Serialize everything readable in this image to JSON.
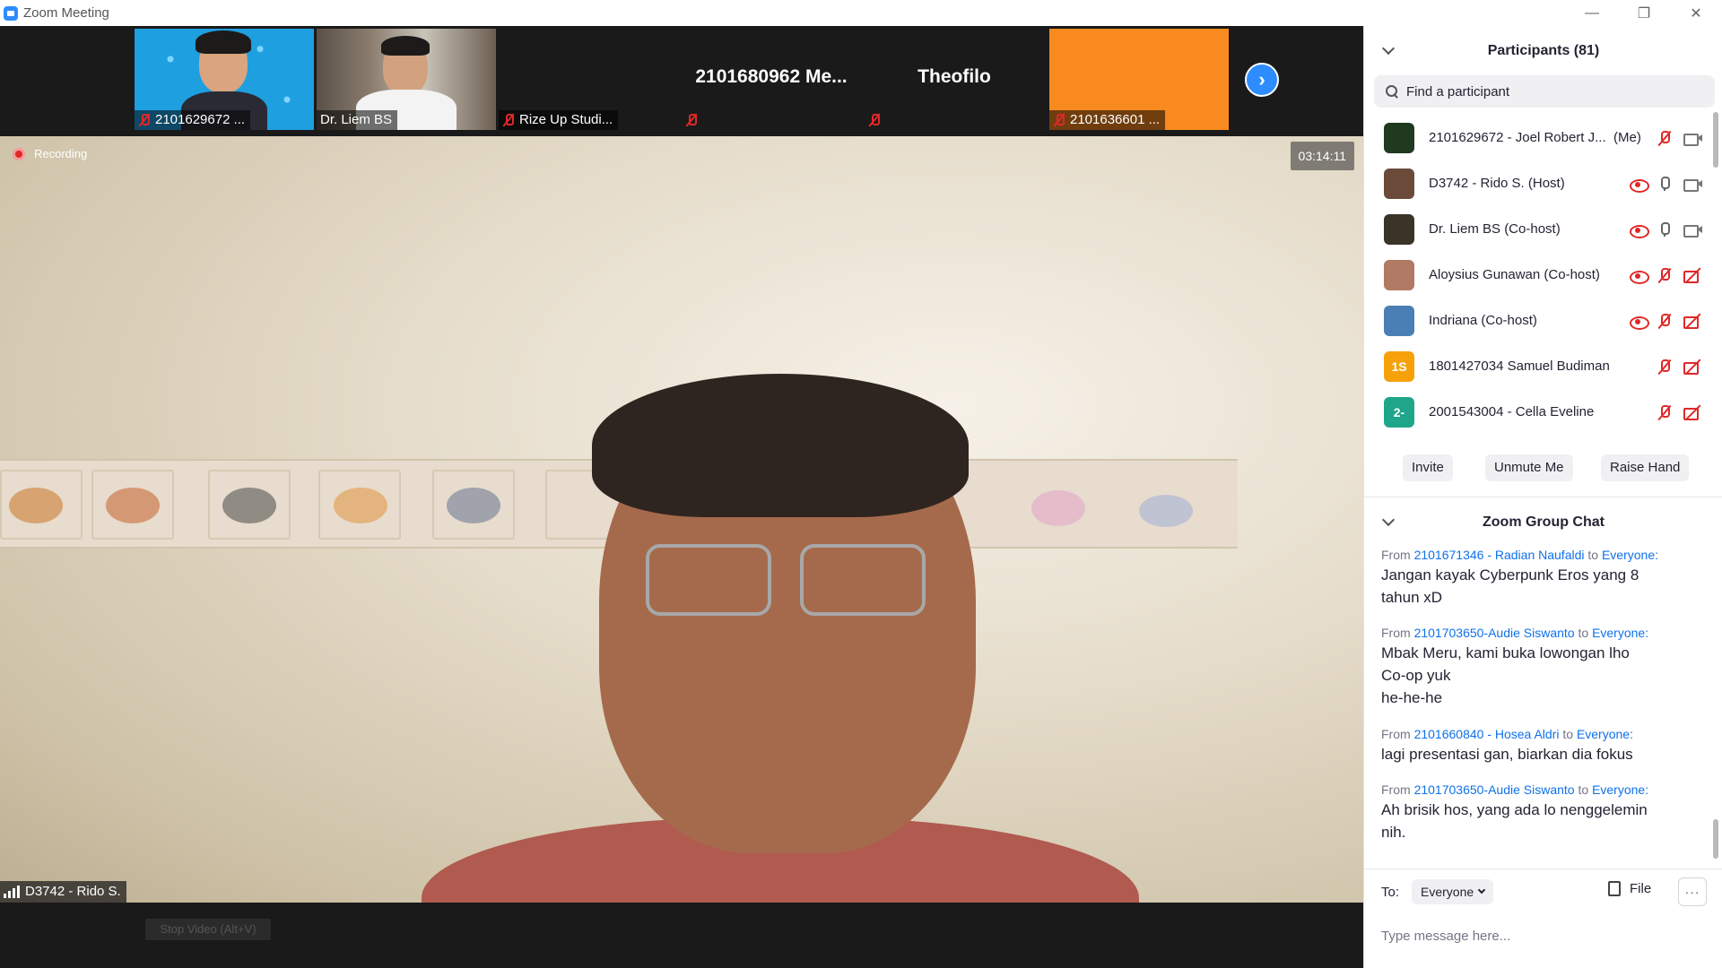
{
  "window": {
    "title": "Zoom Meeting",
    "controls": [
      "—",
      "❐",
      "✕"
    ]
  },
  "thumbnails": [
    {
      "name": "2101629672 ...",
      "video": true,
      "muted": true
    },
    {
      "name": "Dr. Liem BS",
      "video": true,
      "muted": false
    },
    {
      "name": "Rize Up Studi...",
      "video": false,
      "muted": true
    },
    {
      "name": "",
      "display_name": "2101680962  Me...",
      "video": false,
      "muted": true
    },
    {
      "name": "",
      "display_name": "Theofilo",
      "video": false,
      "muted": true
    },
    {
      "name": "2101636601 ...",
      "video": false,
      "muted": true,
      "bg_color": "#f98a1f"
    }
  ],
  "main_video": {
    "recording_label": "Recording",
    "timer": "03:14:11",
    "speaker_name": "D3742 - Rido S."
  },
  "toolbar": {
    "ghost_label": "Stop Video (Alt+V)"
  },
  "participants": {
    "title": "Participants (81)",
    "search_placeholder": "Find a participant",
    "list": [
      {
        "name": "2101629672 - Joel Robert J...",
        "suffix": "(Me)",
        "avatar_text": "",
        "avatar_color": "#1f3a1f",
        "recording": false,
        "mic": "muted",
        "camera": "on"
      },
      {
        "name": "D3742 - Rido S. (Host)",
        "suffix": "",
        "avatar_text": "",
        "avatar_color": "#6b4a3a",
        "recording": true,
        "mic": "on",
        "camera": "on"
      },
      {
        "name": "Dr. Liem BS (Co-host)",
        "suffix": "",
        "avatar_text": "",
        "avatar_color": "#3a3428",
        "recording": true,
        "mic": "on",
        "camera": "on"
      },
      {
        "name": "Aloysius Gunawan (Co-host)",
        "suffix": "",
        "avatar_text": "",
        "avatar_color": "#b07a64",
        "recording": true,
        "mic": "muted",
        "camera": "off"
      },
      {
        "name": "Indriana (Co-host)",
        "suffix": "",
        "avatar_text": "",
        "avatar_color": "#4a7fb5",
        "recording": true,
        "mic": "muted",
        "camera": "off"
      },
      {
        "name": "1801427034 Samuel Budiman",
        "suffix": "",
        "avatar_text": "1S",
        "avatar_color": "#f7a10a",
        "recording": false,
        "mic": "muted",
        "camera": "off"
      },
      {
        "name": "2001543004 - Cella Eveline",
        "suffix": "",
        "avatar_text": "2-",
        "avatar_color": "#1fa68a",
        "recording": false,
        "mic": "muted",
        "camera": "off"
      }
    ],
    "buttons": {
      "invite": "Invite",
      "unmute": "Unmute Me",
      "raise_hand": "Raise Hand"
    }
  },
  "chat": {
    "title": "Zoom Group Chat",
    "from_word": "From",
    "to_word": "to",
    "messages": [
      {
        "sender": "2101671346 - Radian Naufaldi",
        "recipient": "Everyone:",
        "text": "Jangan kayak Cyberpunk Eros yang 8\ntahun xD"
      },
      {
        "sender": "2101703650-Audie Siswanto",
        "recipient": "Everyone:",
        "text": "Mbak Meru, kami buka lowongan lho\nCo-op yuk\nhe-he-he"
      },
      {
        "sender": "2101660840 - Hosea Aldri",
        "recipient": "Everyone:",
        "text": "lagi presentasi gan, biarkan dia fokus"
      },
      {
        "sender": "2101703650-Audie Siswanto",
        "recipient": "Everyone:",
        "text": "Ah brisik hos, yang ada lo nenggelemin\nnih."
      }
    ],
    "to_label": "To:",
    "recipient_select": "Everyone",
    "file_label": "File",
    "more_label": "···",
    "input_placeholder": "Type message here..."
  }
}
